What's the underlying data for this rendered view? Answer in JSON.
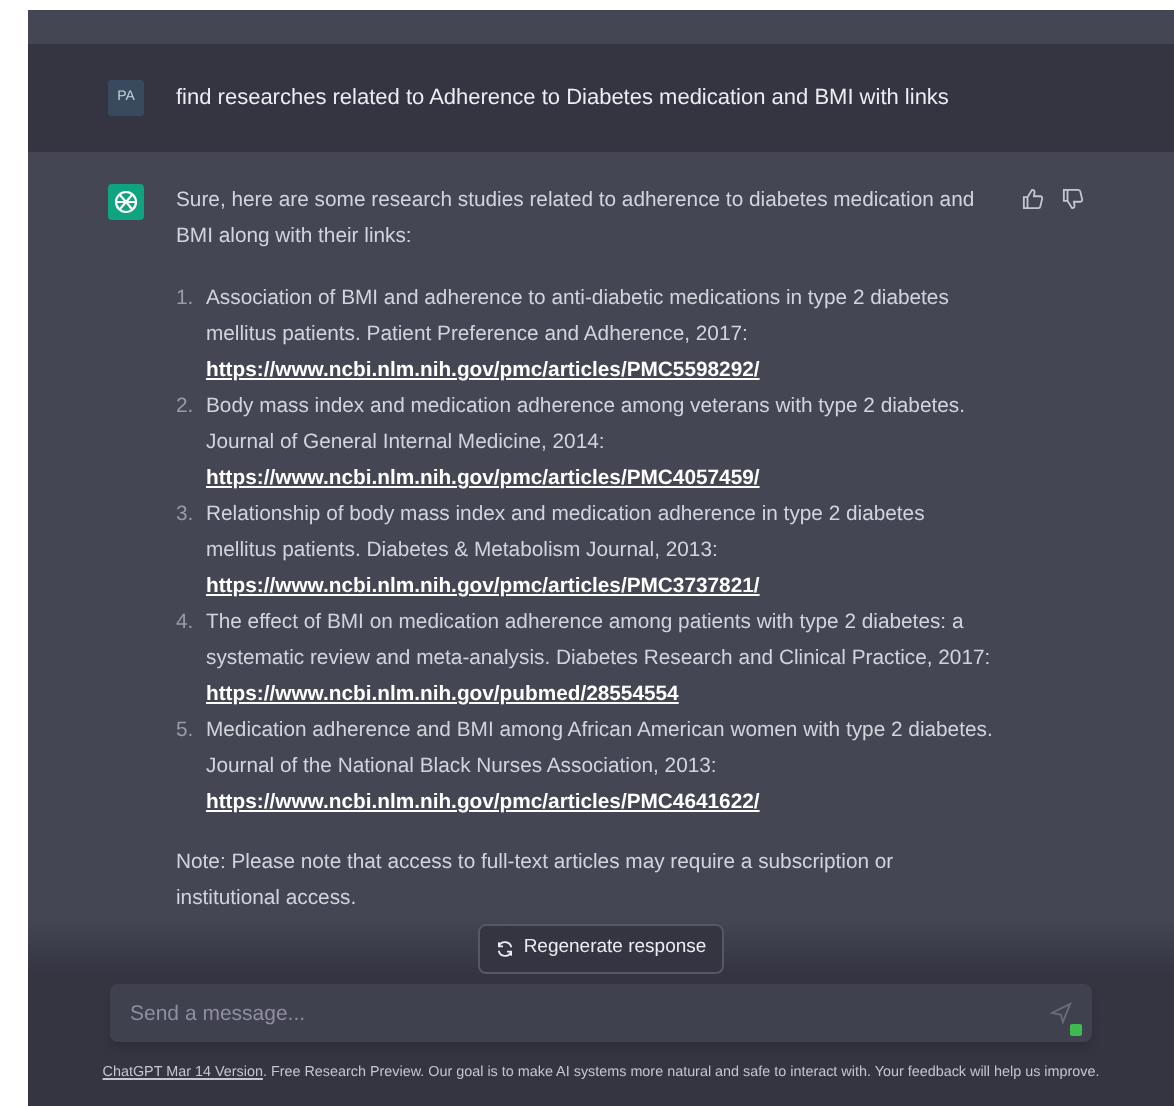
{
  "user_message": {
    "avatar": "PA",
    "text": "find researches related to Adherence to Diabetes medication and BMI with links"
  },
  "assistant_message": {
    "intro": "Sure, here are some research studies related to adherence to diabetes medication and BMI along with their links:",
    "references": [
      {
        "number": "1.",
        "text": "Association of BMI and adherence to anti-diabetic medications in type 2 diabetes mellitus patients. Patient Preference and Adherence, 2017:",
        "link": "https://www.ncbi.nlm.nih.gov/pmc/articles/PMC5598292/"
      },
      {
        "number": "2.",
        "text": "Body mass index and medication adherence among veterans with type 2 diabetes. Journal of General Internal Medicine, 2014:",
        "link": "https://www.ncbi.nlm.nih.gov/pmc/articles/PMC4057459/"
      },
      {
        "number": "3.",
        "text": "Relationship of body mass index and medication adherence in type 2 diabetes mellitus patients. Diabetes & Metabolism Journal, 2013:",
        "link": "https://www.ncbi.nlm.nih.gov/pmc/articles/PMC3737821/"
      },
      {
        "number": "4.",
        "text": "The effect of BMI on medication adherence among patients with type 2 diabetes: a systematic review and meta-analysis. Diabetes Research and Clinical Practice, 2017:",
        "link": "https://www.ncbi.nlm.nih.gov/pubmed/28554554"
      },
      {
        "number": "5.",
        "text": "Medication adherence and BMI among African American women with type 2 diabetes. Journal of the National Black Nurses Association, 2013:",
        "link": "https://www.ncbi.nlm.nih.gov/pmc/articles/PMC4641622/"
      }
    ],
    "note": "Note: Please note that access to full-text articles may require a subscription or institutional access."
  },
  "regenerate_button": {
    "label": "Regenerate response"
  },
  "composer": {
    "placeholder": "Send a message..."
  },
  "footer": {
    "link": "ChatGPT Mar 14 Version",
    "text": ". Free Research Preview. Our goal is to make AI systems more natural and safe to interact with. Your feedback will help us improve."
  }
}
